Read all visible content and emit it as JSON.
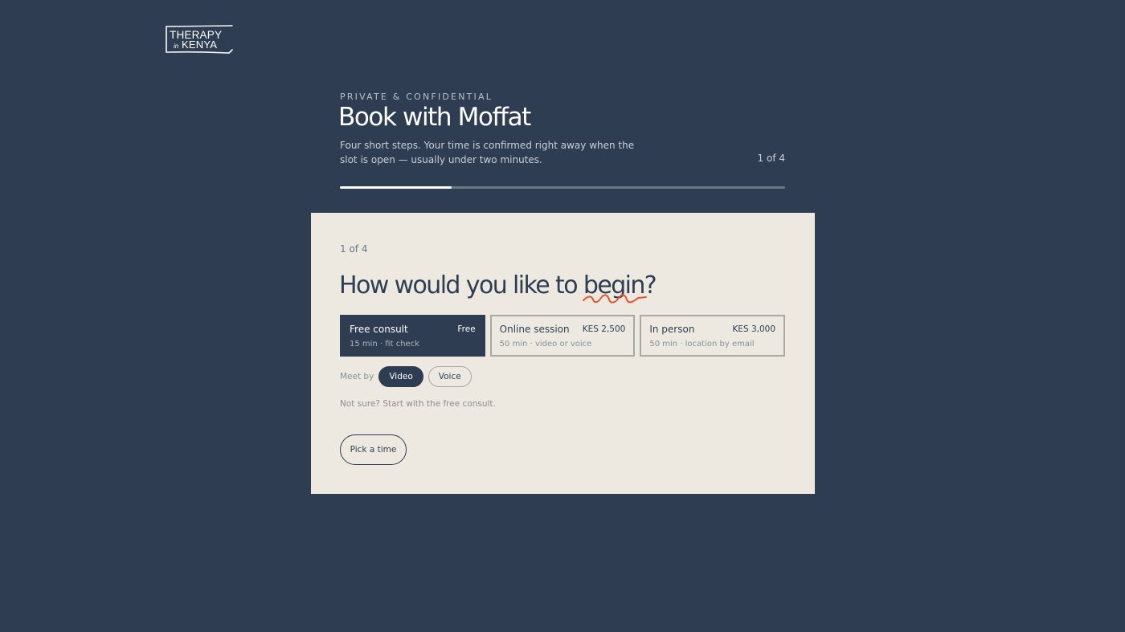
{
  "brand": {
    "logo_line1": "THERAPY",
    "logo_in": "in",
    "logo_line2": "KENYA"
  },
  "header": {
    "eyebrow": "PRIVATE & CONFIDENTIAL",
    "title": "Book with Moffat",
    "subtitle": "Four short steps. Your time is confirmed right away when the slot is open — usually under two minutes.",
    "step_count": "1 of 4",
    "progress_fraction": 0.25
  },
  "card": {
    "step_label": "1 of 4",
    "question_start": "How would you like to ",
    "question_emph": "begin",
    "question_end": "?",
    "options": [
      {
        "name": "Free consult",
        "price": "Free",
        "meta": "15 min · fit check",
        "selected": true
      },
      {
        "name": "Online session",
        "price": "KES 2,500",
        "meta": "50 min · video or voice",
        "selected": false
      },
      {
        "name": "In person",
        "price": "KES 3,000",
        "meta": "50 min · location by email",
        "selected": false
      }
    ],
    "meet_by": {
      "label": "Meet by",
      "choices": [
        "Video",
        "Voice"
      ],
      "selected": "Video"
    },
    "hint": "Not sure? Start with the free consult.",
    "cta_label": "Pick a time"
  },
  "colors": {
    "background": "#2e3d52",
    "card": "#ede9e1",
    "accent": "#e0562b"
  }
}
